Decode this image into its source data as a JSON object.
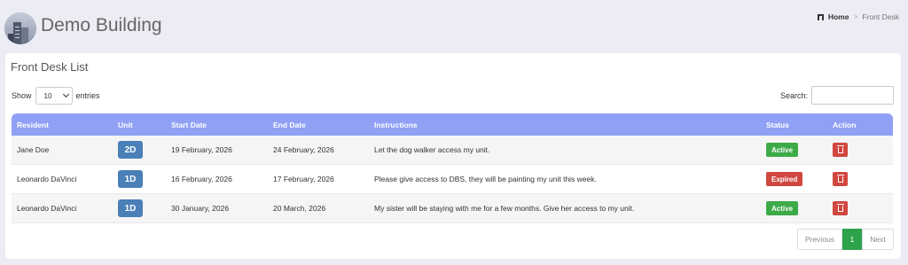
{
  "header": {
    "title": "Demo Building",
    "breadcrumb": {
      "home": "Home",
      "separator": ">",
      "current": "Front Desk"
    }
  },
  "card": {
    "title": "Front Desk List"
  },
  "controls": {
    "show_label": "Show",
    "entries_value": "10",
    "entries_label": "entries",
    "search_label": "Search:",
    "search_value": ""
  },
  "table": {
    "headers": {
      "resident": "Resident",
      "unit": "Unit",
      "start": "Start Date",
      "end": "End Date",
      "instructions": "Instructions",
      "status": "Status",
      "action": "Action"
    },
    "rows": [
      {
        "resident": "Jane Doe",
        "unit": "2D",
        "start": "19 February, 2026",
        "end": "24 February, 2026",
        "instructions": "Let the dog walker access my unit.",
        "status": "Active"
      },
      {
        "resident": "Leonardo DaVinci",
        "unit": "1D",
        "start": "16 February, 2026",
        "end": "17 February, 2026",
        "instructions": "Please give access to DBS, they will be painting my unit this week.",
        "status": "Expired"
      },
      {
        "resident": "Leonardo DaVinci",
        "unit": "1D",
        "start": "30 January, 2026",
        "end": "20 March, 2026",
        "instructions": "My sister will be staying with me for a few months. Give her access to my unit.",
        "status": "Active"
      }
    ]
  },
  "pagination": {
    "previous": "Previous",
    "current": "1",
    "next": "Next"
  },
  "colors": {
    "header_row": "#8fa0f5",
    "unit_badge": "#4a7fb8",
    "status_active": "#3daa48",
    "status_expired": "#d0473f",
    "page_active": "#2ea24a"
  },
  "icons": {
    "logo": "building-photo-icon",
    "breadcrumb": "building-icon",
    "delete": "trash-icon"
  }
}
